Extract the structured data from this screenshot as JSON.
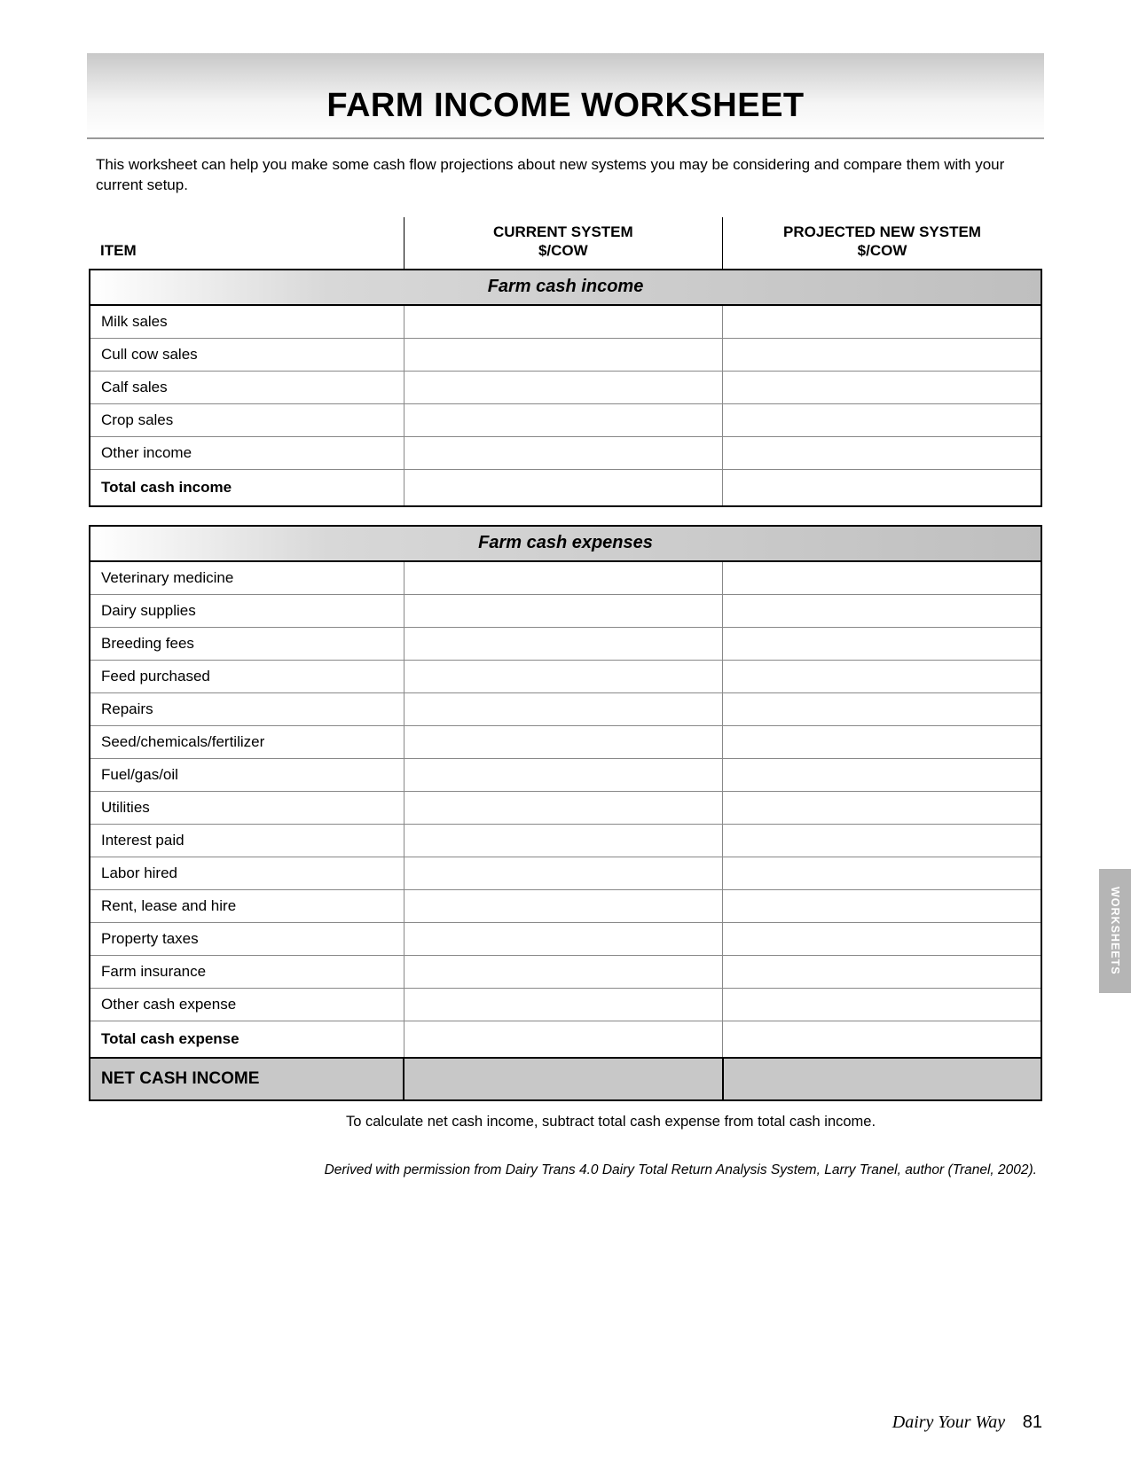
{
  "header": {
    "title": "FARM INCOME WORKSHEET"
  },
  "intro": "This worksheet can help you make some cash flow projections about new systems you may be considering and compare them with your current setup.",
  "columns": {
    "item": "ITEM",
    "current_line1": "CURRENT SYSTEM",
    "current_line2": "$/COW",
    "projected_line1": "PROJECTED NEW SYSTEM",
    "projected_line2": "$/COW"
  },
  "sections": {
    "income": {
      "heading": "Farm cash income",
      "rows": [
        {
          "label": "Milk sales",
          "current": "",
          "projected": ""
        },
        {
          "label": "Cull cow sales",
          "current": "",
          "projected": ""
        },
        {
          "label": "Calf sales",
          "current": "",
          "projected": ""
        },
        {
          "label": "Crop sales",
          "current": "",
          "projected": ""
        },
        {
          "label": "Other income",
          "current": "",
          "projected": ""
        }
      ],
      "total": {
        "label": "Total cash income",
        "current": "",
        "projected": ""
      }
    },
    "expenses": {
      "heading": "Farm cash expenses",
      "rows": [
        {
          "label": "Veterinary medicine",
          "current": "",
          "projected": ""
        },
        {
          "label": "Dairy supplies",
          "current": "",
          "projected": ""
        },
        {
          "label": "Breeding fees",
          "current": "",
          "projected": ""
        },
        {
          "label": "Feed purchased",
          "current": "",
          "projected": ""
        },
        {
          "label": "Repairs",
          "current": "",
          "projected": ""
        },
        {
          "label": "Seed/chemicals/fertilizer",
          "current": "",
          "projected": ""
        },
        {
          "label": "Fuel/gas/oil",
          "current": "",
          "projected": ""
        },
        {
          "label": "Utilities",
          "current": "",
          "projected": ""
        },
        {
          "label": "Interest paid",
          "current": "",
          "projected": ""
        },
        {
          "label": "Labor hired",
          "current": "",
          "projected": ""
        },
        {
          "label": "Rent, lease and hire",
          "current": "",
          "projected": ""
        },
        {
          "label": "Property taxes",
          "current": "",
          "projected": ""
        },
        {
          "label": "Farm insurance",
          "current": "",
          "projected": ""
        },
        {
          "label": "Other cash expense",
          "current": "",
          "projected": ""
        }
      ],
      "total": {
        "label": "Total cash expense",
        "current": "",
        "projected": ""
      }
    }
  },
  "net": {
    "label": "NET CASH INCOME",
    "current": "",
    "projected": ""
  },
  "note": "To calculate net cash income, subtract total cash expense from total cash income.",
  "credit": "Derived with permission from Dairy Trans 4.0 Dairy Total Return Analysis System, Larry Tranel, author (Tranel, 2002).",
  "side_tab": "WORKSHEETS",
  "footer": {
    "book_title": "Dairy Your Way",
    "page_number": "81"
  }
}
